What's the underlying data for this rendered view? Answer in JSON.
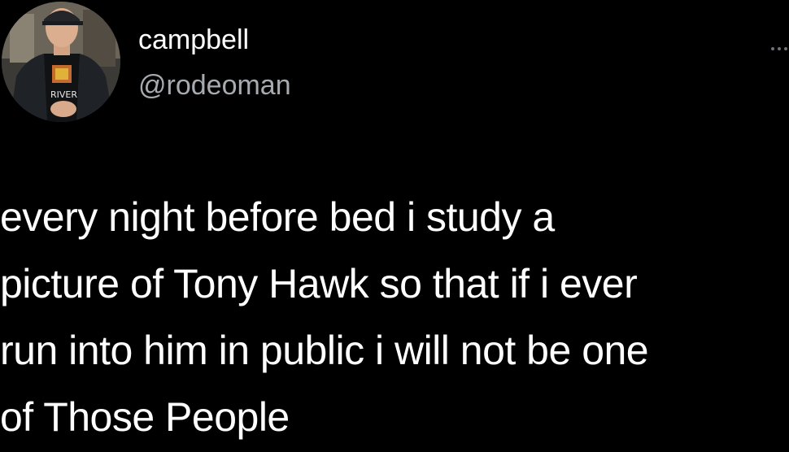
{
  "author": {
    "display_name": "campbell",
    "handle": "@rodeoman",
    "avatar_shirt_text": "RIVER"
  },
  "tweet": {
    "lines": [
      "every night before bed i study a",
      "picture of Tony Hawk so that if i ever",
      "run into him in public i will not be one",
      "of Those People"
    ]
  },
  "icons": {
    "more": "more-options-icon"
  },
  "colors": {
    "background": "#000000",
    "text": "#ffffff",
    "handle": "#a7abb0"
  }
}
